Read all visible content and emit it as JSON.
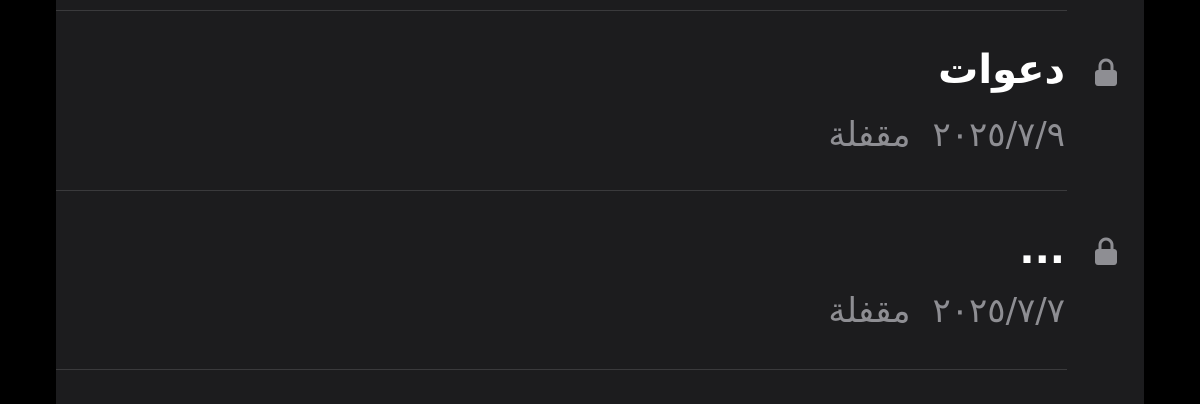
{
  "colors": {
    "background": "#000000",
    "panel": "#1c1c1e",
    "separator": "#3a3a3c",
    "title": "#ffffff",
    "secondary": "#8e8e93",
    "lock_icon": "#8e8e93"
  },
  "notes": [
    {
      "title": "دعوات",
      "date": "٢٠٢٥/٧/٩",
      "status": "مقفلة",
      "icon": "lock-icon"
    },
    {
      "title": "...",
      "date": "٢٠٢٥/٧/٧",
      "status": "مقفلة",
      "icon": "lock-icon"
    }
  ]
}
